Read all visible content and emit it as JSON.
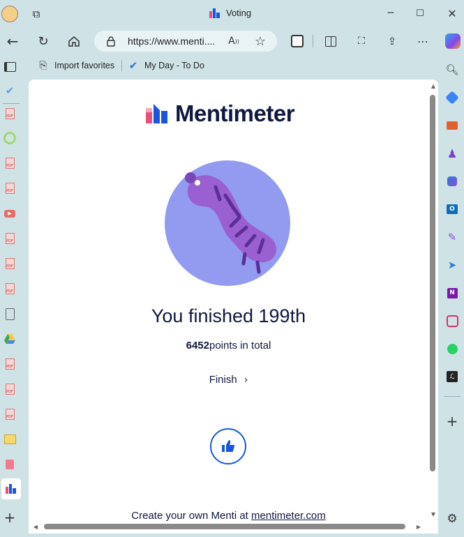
{
  "browser": {
    "tab_title": "Voting",
    "url": "https://www.menti....",
    "favorites": [
      {
        "label": "Import favorites"
      },
      {
        "label": "My Day - To Do"
      }
    ]
  },
  "page": {
    "brand": "Mentimeter",
    "result_heading": "You finished 199th",
    "points_value": "6452",
    "points_suffix": "points in total",
    "finish_label": "Finish",
    "footer_prefix": "Create your own Menti at",
    "footer_link": "mentimeter.com"
  },
  "colors": {
    "accent_blue": "#1a56db",
    "illustration_circle": "#929bf0",
    "worm_body": "#9a5fd0",
    "worm_stripes": "#5b2f95"
  }
}
